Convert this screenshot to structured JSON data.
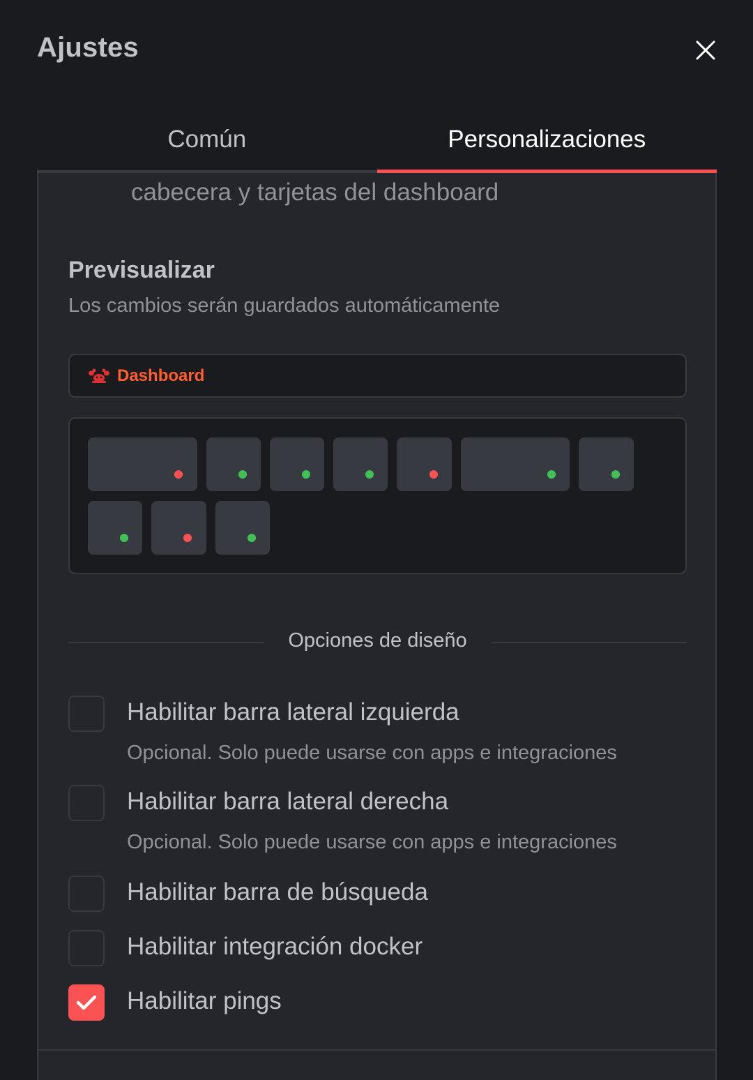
{
  "modal": {
    "title": "Ajustes"
  },
  "tabs": [
    {
      "label": "Común",
      "active": false
    },
    {
      "label": "Personalizaciones",
      "active": true
    }
  ],
  "content": {
    "cut_description": "cabecera y tarjetas del dashboard",
    "preview": {
      "title": "Previsualizar",
      "subtitle": "Los cambios serán guardados automáticamente",
      "header_brand": "Dashboard",
      "header_icon": "dashboard-logo-icon",
      "tile_status": [
        "red",
        "green",
        "green",
        "green",
        "red",
        "green",
        "green",
        "green",
        "red",
        "green"
      ]
    },
    "design_options": {
      "divider_label": "Opciones de diseño",
      "items": [
        {
          "label": "Habilitar barra lateral izquierda",
          "description": "Opcional. Solo puede usarse con apps e integraciones",
          "checked": false
        },
        {
          "label": "Habilitar barra lateral derecha",
          "description": "Opcional. Solo puede usarse con apps e integraciones",
          "checked": false
        },
        {
          "label": "Habilitar barra de búsqueda",
          "description": "",
          "checked": false
        },
        {
          "label": "Habilitar integración docker",
          "description": "",
          "checked": false
        },
        {
          "label": "Habilitar pings",
          "description": "",
          "checked": true
        }
      ]
    }
  },
  "colors": {
    "background": "#1a1b1e",
    "panel": "#25262b",
    "border": "#373a40",
    "accent": "#fa5252",
    "brand": "#fd5e2c",
    "status_green": "#40c057",
    "status_red": "#fa5252"
  }
}
